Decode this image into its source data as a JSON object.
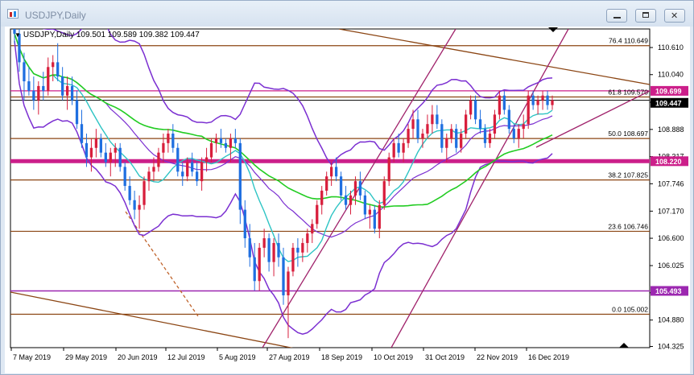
{
  "window": {
    "title": "USDJPY,Daily"
  },
  "chart_header": {
    "symbol": "USDJPY,Daily",
    "ohlc": "109.501 109.589 109.382 109.447"
  },
  "chart_data": {
    "type": "candlestick",
    "symbol": "USDJPY",
    "timeframe": "Daily",
    "ylim": [
      104.3,
      111.0
    ],
    "y_ticks": [
      "110.610",
      "110.040",
      "109.459",
      "108.888",
      "108.317",
      "107.746",
      "107.170",
      "106.600",
      "106.025",
      "105.454",
      "104.880",
      "104.325"
    ],
    "x_ticks": [
      "7 May 2019",
      "29 May 2019",
      "20 Jun 2019",
      "12 Jul 2019",
      "5 Aug 2019",
      "27 Aug 2019",
      "18 Sep 2019",
      "10 Oct 2019",
      "31 Oct 2019",
      "22 Nov 2019",
      "16 Dec 2019"
    ],
    "price_tags": [
      {
        "value": 109.699,
        "label": "109.699",
        "color": "#cc1f8a"
      },
      {
        "value": 109.447,
        "label": "109.447",
        "color": "#000000"
      },
      {
        "value": 108.22,
        "label": "108.220",
        "color": "#cc1f8a"
      },
      {
        "value": 105.493,
        "label": "105.493",
        "color": "#9c27b0"
      }
    ],
    "horizontal_lines": [
      {
        "value": 109.699,
        "color": "#cc1f8a",
        "width": 1.2
      },
      {
        "value": 108.22,
        "color": "#cc1f8a",
        "width": 5
      },
      {
        "value": 105.493,
        "color": "#9c27b0",
        "width": 1.5
      }
    ],
    "fibonacci": [
      {
        "label": "76.4  110.649",
        "value": 110.649
      },
      {
        "label": "61.8  109.570",
        "value": 109.57
      },
      {
        "label": "50.0  108.697",
        "value": 108.697
      },
      {
        "label": "38.2  107.825",
        "value": 107.825
      },
      {
        "label": "23.6  106.746",
        "value": 106.746
      },
      {
        "label": "0.0  105.002",
        "value": 105.002
      }
    ],
    "candles_ohlc": [
      [
        111.6,
        111.8,
        110.7,
        110.9
      ],
      [
        110.9,
        111.0,
        110.1,
        110.3
      ],
      [
        110.3,
        110.5,
        109.5,
        109.9
      ],
      [
        109.9,
        110.2,
        109.6,
        109.7
      ],
      [
        109.7,
        110.0,
        109.3,
        109.5
      ],
      [
        109.5,
        109.9,
        109.2,
        109.8
      ],
      [
        109.8,
        110.1,
        109.5,
        109.7
      ],
      [
        109.7,
        110.4,
        109.6,
        110.2
      ],
      [
        110.2,
        110.45,
        109.9,
        110.3
      ],
      [
        110.3,
        110.7,
        109.9,
        110.0
      ],
      [
        110.0,
        110.2,
        109.5,
        109.6
      ],
      [
        109.6,
        110.0,
        109.3,
        109.8
      ],
      [
        109.8,
        110.0,
        109.4,
        109.5
      ],
      [
        109.5,
        109.7,
        108.9,
        109.0
      ],
      [
        109.0,
        109.3,
        108.5,
        108.6
      ],
      [
        108.6,
        108.8,
        108.1,
        108.3
      ],
      [
        108.3,
        108.7,
        108.0,
        108.5
      ],
      [
        108.5,
        108.9,
        108.3,
        108.7
      ],
      [
        108.7,
        108.8,
        108.3,
        108.4
      ],
      [
        108.4,
        108.6,
        108.1,
        108.2
      ],
      [
        108.2,
        108.5,
        107.9,
        108.4
      ],
      [
        108.4,
        108.6,
        108.1,
        108.5
      ],
      [
        108.5,
        108.6,
        108.0,
        108.1
      ],
      [
        108.1,
        108.2,
        107.6,
        107.7
      ],
      [
        107.7,
        107.9,
        107.3,
        107.4
      ],
      [
        107.4,
        107.6,
        107.0,
        107.2
      ],
      [
        107.2,
        107.5,
        106.8,
        107.3
      ],
      [
        107.3,
        107.9,
        107.2,
        107.8
      ],
      [
        107.8,
        108.1,
        107.6,
        108.0
      ],
      [
        108.0,
        108.3,
        107.8,
        108.1
      ],
      [
        108.1,
        108.5,
        108.0,
        108.4
      ],
      [
        108.4,
        108.8,
        108.2,
        108.6
      ],
      [
        108.6,
        108.9,
        108.4,
        108.8
      ],
      [
        108.8,
        109.0,
        108.4,
        108.5
      ],
      [
        108.5,
        108.6,
        107.9,
        108.0
      ],
      [
        108.0,
        108.2,
        107.7,
        107.9
      ],
      [
        107.9,
        108.3,
        107.8,
        108.2
      ],
      [
        108.2,
        108.4,
        107.9,
        108.0
      ],
      [
        108.0,
        108.2,
        107.7,
        107.8
      ],
      [
        107.8,
        108.3,
        107.6,
        108.2
      ],
      [
        108.2,
        108.5,
        108.0,
        108.3
      ],
      [
        108.3,
        108.7,
        108.2,
        108.6
      ],
      [
        108.6,
        108.8,
        108.4,
        108.7
      ],
      [
        108.7,
        108.9,
        108.5,
        108.6
      ],
      [
        108.6,
        108.7,
        108.4,
        108.5
      ],
      [
        108.5,
        108.8,
        108.2,
        108.7
      ],
      [
        108.7,
        108.9,
        108.5,
        108.6
      ],
      [
        108.6,
        108.7,
        106.9,
        107.2
      ],
      [
        107.2,
        107.4,
        106.4,
        106.6
      ],
      [
        106.6,
        106.9,
        106.0,
        106.2
      ],
      [
        106.2,
        106.5,
        105.5,
        105.7
      ],
      [
        105.7,
        106.5,
        105.5,
        106.4
      ],
      [
        106.4,
        106.8,
        106.2,
        106.6
      ],
      [
        106.6,
        106.7,
        105.9,
        106.1
      ],
      [
        106.1,
        106.6,
        105.8,
        106.5
      ],
      [
        106.5,
        106.7,
        106.0,
        106.2
      ],
      [
        106.2,
        106.4,
        105.2,
        105.4
      ],
      [
        105.4,
        106.0,
        104.5,
        105.9
      ],
      [
        105.9,
        106.5,
        105.8,
        106.4
      ],
      [
        106.4,
        106.6,
        106.0,
        106.3
      ],
      [
        106.3,
        106.6,
        106.1,
        106.5
      ],
      [
        106.5,
        106.8,
        106.3,
        106.7
      ],
      [
        106.7,
        107.0,
        106.5,
        106.9
      ],
      [
        106.9,
        107.4,
        106.8,
        107.3
      ],
      [
        107.3,
        107.7,
        107.1,
        107.6
      ],
      [
        107.6,
        108.0,
        107.5,
        107.9
      ],
      [
        107.9,
        108.2,
        107.7,
        108.1
      ],
      [
        108.1,
        108.3,
        107.8,
        107.9
      ],
      [
        107.9,
        108.0,
        107.4,
        107.5
      ],
      [
        107.5,
        107.7,
        107.2,
        107.3
      ],
      [
        107.3,
        107.6,
        107.1,
        107.5
      ],
      [
        107.5,
        107.9,
        107.3,
        107.8
      ],
      [
        107.8,
        108.0,
        107.4,
        107.5
      ],
      [
        107.5,
        107.6,
        107.0,
        107.1
      ],
      [
        107.1,
        107.3,
        106.8,
        107.2
      ],
      [
        107.2,
        107.3,
        106.7,
        106.8
      ],
      [
        106.8,
        107.4,
        106.6,
        107.3
      ],
      [
        107.3,
        107.9,
        107.2,
        107.8
      ],
      [
        107.8,
        108.4,
        107.7,
        108.3
      ],
      [
        108.3,
        108.7,
        108.2,
        108.6
      ],
      [
        108.6,
        108.8,
        108.3,
        108.4
      ],
      [
        108.4,
        108.7,
        108.2,
        108.6
      ],
      [
        108.6,
        109.0,
        108.5,
        108.9
      ],
      [
        108.9,
        109.3,
        108.7,
        109.1
      ],
      [
        109.1,
        109.3,
        108.6,
        108.7
      ],
      [
        108.7,
        108.9,
        108.5,
        108.8
      ],
      [
        108.8,
        109.2,
        108.7,
        109.0
      ],
      [
        109.0,
        109.4,
        108.8,
        109.2
      ],
      [
        109.2,
        109.4,
        108.9,
        109.0
      ],
      [
        109.0,
        109.1,
        108.4,
        108.5
      ],
      [
        108.5,
        108.8,
        108.2,
        108.7
      ],
      [
        108.7,
        109.0,
        108.6,
        108.9
      ],
      [
        108.9,
        109.0,
        108.4,
        108.5
      ],
      [
        108.5,
        108.9,
        108.4,
        108.8
      ],
      [
        108.8,
        109.3,
        108.7,
        109.2
      ],
      [
        109.2,
        109.6,
        109.1,
        109.5
      ],
      [
        109.5,
        109.6,
        109.0,
        109.1
      ],
      [
        109.1,
        109.3,
        108.8,
        108.9
      ],
      [
        108.9,
        109.0,
        108.5,
        108.6
      ],
      [
        108.6,
        108.9,
        108.5,
        108.8
      ],
      [
        108.8,
        109.3,
        108.7,
        109.2
      ],
      [
        109.2,
        109.7,
        109.1,
        109.6
      ],
      [
        109.6,
        109.7,
        109.2,
        109.3
      ],
      [
        109.3,
        109.4,
        108.8,
        108.9
      ],
      [
        108.9,
        109.0,
        108.6,
        108.7
      ],
      [
        108.7,
        109.0,
        108.5,
        108.9
      ],
      [
        108.9,
        109.2,
        108.7,
        109.0
      ],
      [
        109.0,
        109.7,
        108.9,
        109.6
      ],
      [
        109.6,
        109.7,
        109.3,
        109.4
      ],
      [
        109.4,
        109.6,
        109.2,
        109.5
      ],
      [
        109.5,
        109.7,
        109.3,
        109.6
      ],
      [
        109.6,
        109.7,
        109.3,
        109.4
      ],
      [
        109.4,
        109.6,
        109.3,
        109.5
      ]
    ],
    "indicators": [
      "Bollinger Bands",
      "Moving Average (green)",
      "Moving Average (cyan)",
      "Trend channel"
    ]
  }
}
